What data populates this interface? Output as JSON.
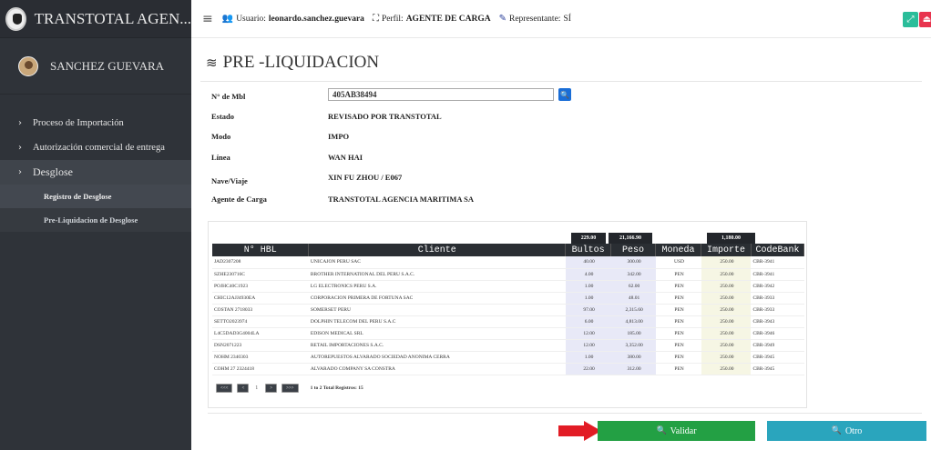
{
  "brand": {
    "title": "TRANSTOTAL AGEN..."
  },
  "user": {
    "name": "SANCHEZ GUEVARA"
  },
  "menu": {
    "items": [
      {
        "label": "Proceso de Importación"
      },
      {
        "label": "Autorización comercial de entrega"
      },
      {
        "label": "Desglose"
      }
    ],
    "submenu": [
      {
        "label": "Registro de Desglose"
      },
      {
        "label": "Pre-Liquidacion de Desglose"
      }
    ]
  },
  "topbar": {
    "user_label": "Usuario:",
    "user_value": "leonardo.sanchez.guevara",
    "profile_label": "Perfil:",
    "profile_value": "AGENTE DE CARGA",
    "rep_label": "Representante:",
    "rep_value": "SÍ"
  },
  "page": {
    "title": "PRE -LIQUIDACION"
  },
  "form": {
    "mbl_label": "N° de Mbl",
    "mbl_value": "405AB38494",
    "estado_label": "Estado",
    "estado_value": "REVISADO POR TRANSTOTAL",
    "modo_label": "Modo",
    "modo_value": "IMPO",
    "linea_label": "Línea",
    "linea_value": "WAN HAI",
    "nave_label": "Nave/Viaje",
    "nave_value": "XIN FU ZHOU / E067",
    "agente_label": "Agente de Carga",
    "agente_value": "TRANSTOTAL AGENCIA MARITIMA SA"
  },
  "table": {
    "totals": {
      "bultos": "229.00",
      "peso": "21,166.90",
      "importe": "1,180.00"
    },
    "headers": [
      "N° HBL",
      "Cliente",
      "Bultos",
      "Peso",
      "Moneda",
      "Importe",
      "CodeBank"
    ],
    "rows": [
      [
        "JAD2307208",
        "UNICAJON PERU SAC",
        "40.00",
        "300.00",
        "USD",
        "250.00",
        "CBR-3941"
      ],
      [
        "SZHE230716C",
        "BROTHER INTERNATIONAL DEL PERU S.A.C.",
        "4.00",
        "342.00",
        "PEN",
        "250.00",
        "CBR-3941"
      ],
      [
        "POJHC40C1923",
        "LG ELECTRONICS PERU S.A.",
        "1.00",
        "62.00",
        "PEN",
        "250.00",
        "CBR-3942"
      ],
      [
        "CHIC12AJJ4930EA",
        "CORPORACION PRIMERA DE FORTUNA SAC",
        "1.00",
        "48.01",
        "PEN",
        "250.00",
        "CBR-3933"
      ],
      [
        "COSTAN 2718033",
        "SOMERSET PERU",
        "97.00",
        "2,315.60",
        "PEN",
        "250.00",
        "CBR-3933"
      ],
      [
        "SETTO2023974",
        "DOLPHIN TELECOM DEL PERU S.A.C",
        "6.00",
        "4,813.00",
        "PEN",
        "250.00",
        "CBR-3943"
      ],
      [
        "L4C5DAD3G4004LA",
        "EDISON MEDICAL SRL",
        "12.00",
        "185.00",
        "PEN",
        "250.00",
        "CBR-3946"
      ],
      [
        "DSN2071223",
        "RETAIL IMPORTACIONES S.A.C.",
        "12.00",
        "3,352.00",
        "PEN",
        "250.00",
        "CBR-3949"
      ],
      [
        "NOHM 2340303",
        "AUTOREPUESTOS ALVARADO SOCIEDAD ANONIMA CERRA",
        "1.00",
        "380.00",
        "PEN",
        "250.00",
        "CBR-3945"
      ],
      [
        "COHM 27 2324418",
        "ALVARADO COMPANY SA CONSTRA",
        "22.00",
        "312.00",
        "PEN",
        "250.00",
        "CBR-3945"
      ]
    ],
    "pager": {
      "first": "<<<",
      "prev": "<",
      "current": "1",
      "next": ">",
      "last": ">>>",
      "info": "1 to 2 Total Registros: 15"
    }
  },
  "actions": {
    "validar": "Validar",
    "otro": "Otro"
  },
  "colors": {
    "sidebar": "#2f3339",
    "validar": "#23a044",
    "otro": "#2aa5bd",
    "arrow": "#e21c25"
  }
}
